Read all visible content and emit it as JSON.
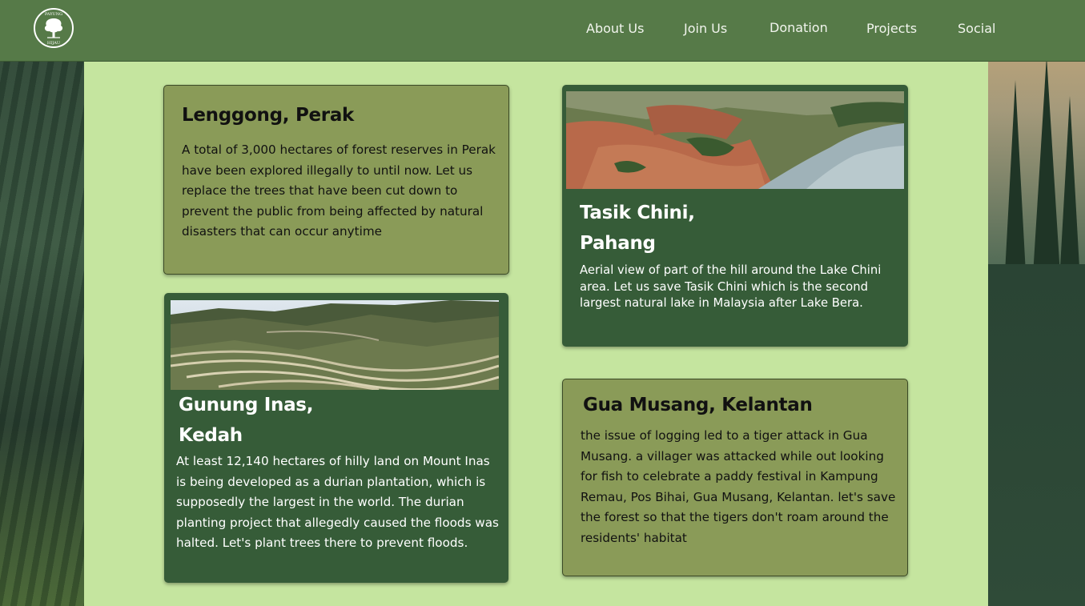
{
  "header": {
    "logo_icon": "tree-logo-icon",
    "logo_text_top": "PAYUNG",
    "logo_text_bottom": "HIJAU",
    "nav": [
      "About Us",
      "Join Us",
      "Donation",
      "Projects",
      "Social"
    ]
  },
  "projects": {
    "lenggong": {
      "title": "Lenggong, Perak",
      "text": "A total of 3,000 hectares of forest reserves in Perak have been explored illegally to until now. Let us replace the trees that have been cut down to prevent the public from being affected by natural disasters that can occur anytime"
    },
    "gunung": {
      "title_line1": "Gunung Inas,",
      "title_line2": "Kedah",
      "image": "terraced-hill-plantation-photo",
      "text": "At least 12,140 hectares of hilly land on Mount Inas is being developed as a durian plantation, which is supposedly the largest in the world. The durian planting project that allegedly caused the floods was halted. Let's plant trees there to prevent floods."
    },
    "tasik": {
      "title_line1": "Tasik Chini,",
      "title_line2": "Pahang",
      "image": "aerial-lake-chini-photo",
      "text": "Aerial view of part of the hill around the Lake Chini area. Let us save Tasik Chini which is  the second largest natural lake in Malaysia after Lake Bera."
    },
    "gua": {
      "title": "Gua Musang, Kelantan",
      "text": "the issue of logging led to a tiger attack in Gua Musang. a villager was attacked while out looking for fish to celebrate a paddy festival in Kampung Remau, Pos Bihai, Gua Musang, Kelantan. let's save the forest so that the tigers don't roam around the residents' habitat"
    }
  },
  "colors": {
    "header_bg": "#567a48",
    "content_bg": "#c5e59f",
    "olive_card": "#8a9b58",
    "dark_card": "#365c38"
  }
}
